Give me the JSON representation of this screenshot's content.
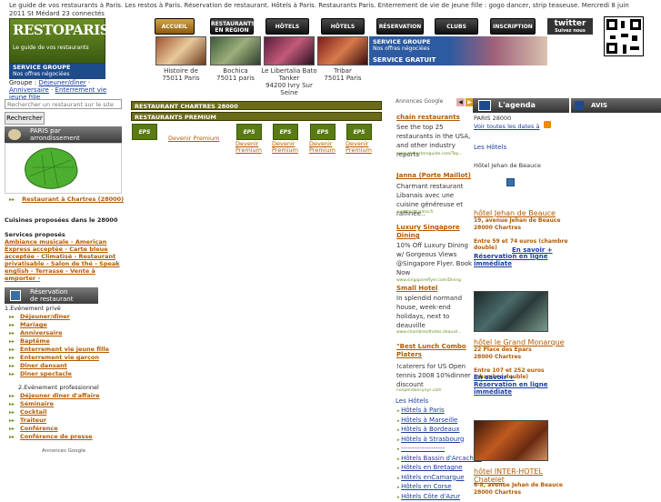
{
  "header": {
    "tagline": "Le guide de vos restaurants à Paris. Les restos à Paris. Réservation de restaurant. Hôtels à Paris. Restaurants Paris. Enterrement de vie de jeune fille : gogo dancer, strip teaseuse. Mercredi 8 juin 2011 St Médard 23 connectés",
    "logo_text": "RESTOPARIS.com",
    "logo_sub": "Le guide de vos restaurants",
    "service_title": "SERVICE GROUPE",
    "service_sub": "Nos offres négociées",
    "breadcrumb_prefix": "Groupe :",
    "breadcrumb_1": "Déjeuner/dîner",
    "breadcrumb_2": "Anniversaire",
    "breadcrumb_3": "Enterrement vie jeune fille"
  },
  "nav": {
    "accueil": "ACCUEIL",
    "restaurants_region_1": "RESTAURANTS",
    "restaurants_region_2": "EN REGION",
    "hotels": "HÔTELS",
    "hotels2": "HÔTELS",
    "reservation": "RÉSERVATION",
    "clubs": "CLUBS",
    "inscription": "INSCRIPTION",
    "twitter": "twitter",
    "twitter_sub": "Suivez nous"
  },
  "thumbs": [
    {
      "name": "Histoire de",
      "place": "75011 Paris"
    },
    {
      "name": "Bochica",
      "place": "75011 paris"
    },
    {
      "name": "Le Libertalia Bato Tanker",
      "place": "94200 Ivry Sur Seine"
    },
    {
      "name": "Tribar",
      "place": "75011 Paris"
    }
  ],
  "banner": {
    "title": "SERVICE GROUPE",
    "sub": "Nos offres négociées",
    "free": "SERVICE GRATUIT"
  },
  "search": {
    "placeholder": "Rechercher un restaurant sur le site",
    "button": "Rechercher"
  },
  "sidebar": {
    "map_head_1": "PARIS par",
    "map_head_2": "arrondissement",
    "restaurant_link": "Restaurant à Chartres (28000)",
    "cuisines": "Cuisines proposées dans le 28000",
    "services_title": "Services proposés",
    "services": "Ambiance musicale - American Express acceptée - Carte bleue acceptée - Climatisé - Restaurant privatisable - Salon de thé - Speak english - Terrasse - Vente à emporter -",
    "resa_head_1": "Réservation",
    "resa_head_2": "de restaurant",
    "prive_title": "1.Evénement privé",
    "prive_items": [
      "Déjeuner/dîner",
      "Mariage",
      "Anniversaire",
      "Baptême",
      "Enterrement vie jeune fille",
      "Enterrement vie garçon",
      "Dîner dansant",
      "Dîner spectacle"
    ],
    "pro_title": "2.Evénement professionnel",
    "pro_items": [
      "Déjeuner dîner d'affaire",
      "Séminaire",
      "Cocktail",
      "Traiteur",
      "Conférence",
      "Conférence de presse"
    ],
    "ads_label": "Annonces Google"
  },
  "main": {
    "bar1": "RESTAURANT CHARTRES 28000",
    "bar2": "RESTAURANTS PREMIUM",
    "premium_label": "Devenir Premium",
    "premium_short_1": "Devenir",
    "premium_short_2": "Premium",
    "premium_box": "EPS"
  },
  "ads": {
    "head": "Annonces Google",
    "items": [
      {
        "title": "chain restaurants",
        "body": "See the top 25 restaurants in the USA, and other industry reports",
        "url": "www.chainstoreguide.com/Top..."
      },
      {
        "title": "Janna (Porte Maillot)",
        "body": "Charmant restaurant Libanais avec une cuisine généreuse et raffinée..",
        "url": "www.restojanna.fr"
      },
      {
        "title": "Luxury Singapore Dining",
        "body": "10% Off Luxury Dining w/ Gorgeous Views @Singapore Flyer. Book Now",
        "url": "www.singaporeflyer.com/Dining"
      },
      {
        "title": "Small Hotel",
        "body": "In splendid normand house, week-end holidays, next to deauville",
        "url": "www.chambresdhotes.deauvil..."
      },
      {
        "title": "\"Best Lunch Combo Platers",
        "body": "!caterers for US Open tennis 2008 10%dinner discount",
        "url": "nonpendancynyc.com"
      }
    ]
  },
  "hotels_box": {
    "title": "Les Hôtels",
    "items": [
      "Hôtels à Paris",
      "Hôtels à Marseille",
      "Hôtels à Bordeaux",
      "Hôtels à Strasbourg",
      "-------------------",
      "Hôtels Bassin d'Arcachon",
      "Hôtels en Bretagne",
      "Hôtels enCamargue",
      "Hôtels en Corse",
      "Hôtels Côte d'Azur"
    ]
  },
  "agenda": {
    "title": "L'agenda",
    "place": "PARIS 28000",
    "link": "Voir toutes les dates à",
    "hotels_title": "Les Hôtels",
    "hotel_intro": "Hôtel Jehan de Beauce"
  },
  "avis": {
    "title": "AVIS D'INTERNAUTES"
  },
  "hotels": [
    {
      "name": "hôtel Jehan de Beauce",
      "addr": "19, avenue Jehan de Beauce",
      "city": "28000 Chartres",
      "price": "Entre 59 et 74 euros (chambre double)",
      "more": "En savoir +",
      "booking": "Réservation en ligne immédiate"
    },
    {
      "name": "hôtel le Grand Monarque",
      "addr": "22 Place des Epars",
      "city": "28000 Chartres",
      "price": "Entre 107 et 252 euros (chambre double)",
      "more": "En savoir +",
      "booking": "Réservation en ligne immédiate"
    },
    {
      "name": "hôtel INTER-HOTEL Chatelet",
      "addr": "6-8, avenue Jehan de Beauce",
      "city": "28000 Chartres"
    }
  ],
  "colors": {
    "accent": "#b35a00",
    "olive": "#6b6b1a",
    "link_blue": "#1a3da0",
    "group_blue": "#1e4b8a"
  }
}
